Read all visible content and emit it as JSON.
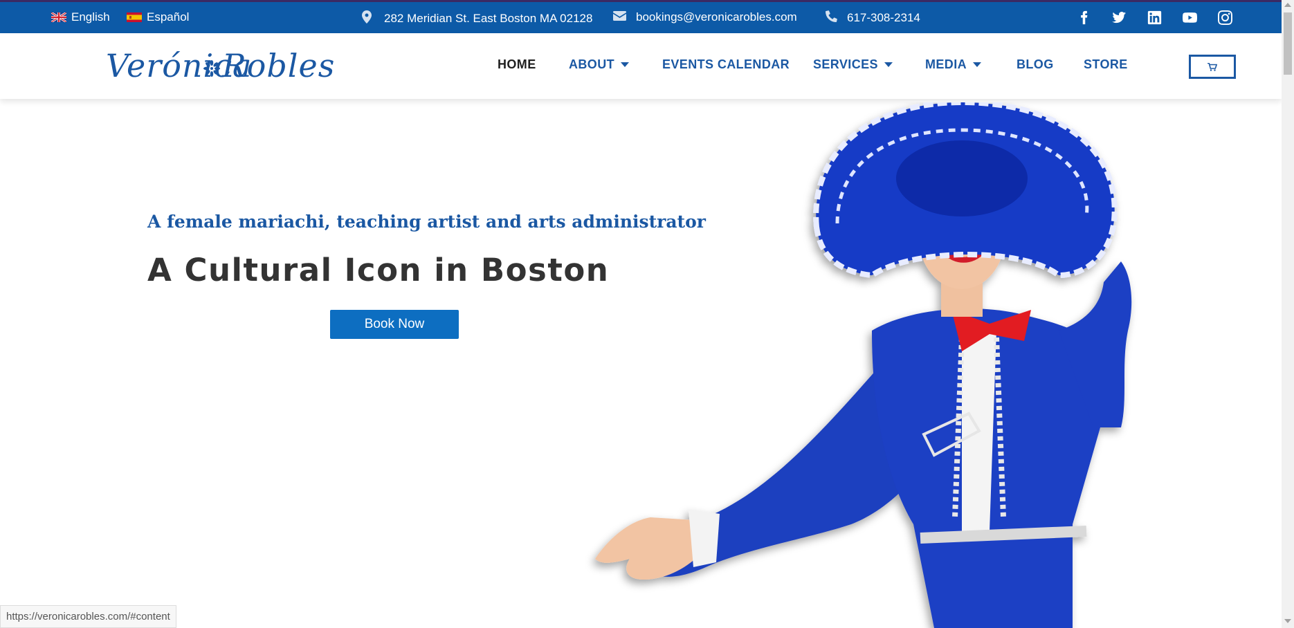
{
  "topbar": {
    "languages": [
      {
        "label": "English",
        "flag": "uk-flag-icon"
      },
      {
        "label": "Español",
        "flag": "spain-flag-icon"
      }
    ],
    "address": "282 Meridian St. East Boston MA 02128",
    "email": "bookings@veronicarobles.com",
    "phone": "617-308-2314",
    "social": [
      "facebook-icon",
      "twitter-icon",
      "linkedin-icon",
      "youtube-icon",
      "instagram-icon"
    ]
  },
  "logo": {
    "first": "Verónica",
    "second": "Robles"
  },
  "nav": {
    "items": [
      {
        "label": "HOME",
        "active": true
      },
      {
        "label": "ABOUT",
        "dropdown": true
      },
      {
        "label": "EVENTS CALENDAR"
      },
      {
        "label": "SERVICES",
        "dropdown": true
      },
      {
        "label": "MEDIA",
        "dropdown": true
      },
      {
        "label": "BLOG"
      },
      {
        "label": "STORE"
      }
    ]
  },
  "hero": {
    "tagline": "A female mariachi, teaching artist and arts administrator",
    "headline": "A Cultural Icon in Boston",
    "button": "Book Now"
  },
  "status": {
    "url": "https://veronicarobles.com/#content"
  },
  "colors": {
    "brand": "#0d5aa7",
    "button": "#0d6ec1",
    "headline": "#333333"
  }
}
